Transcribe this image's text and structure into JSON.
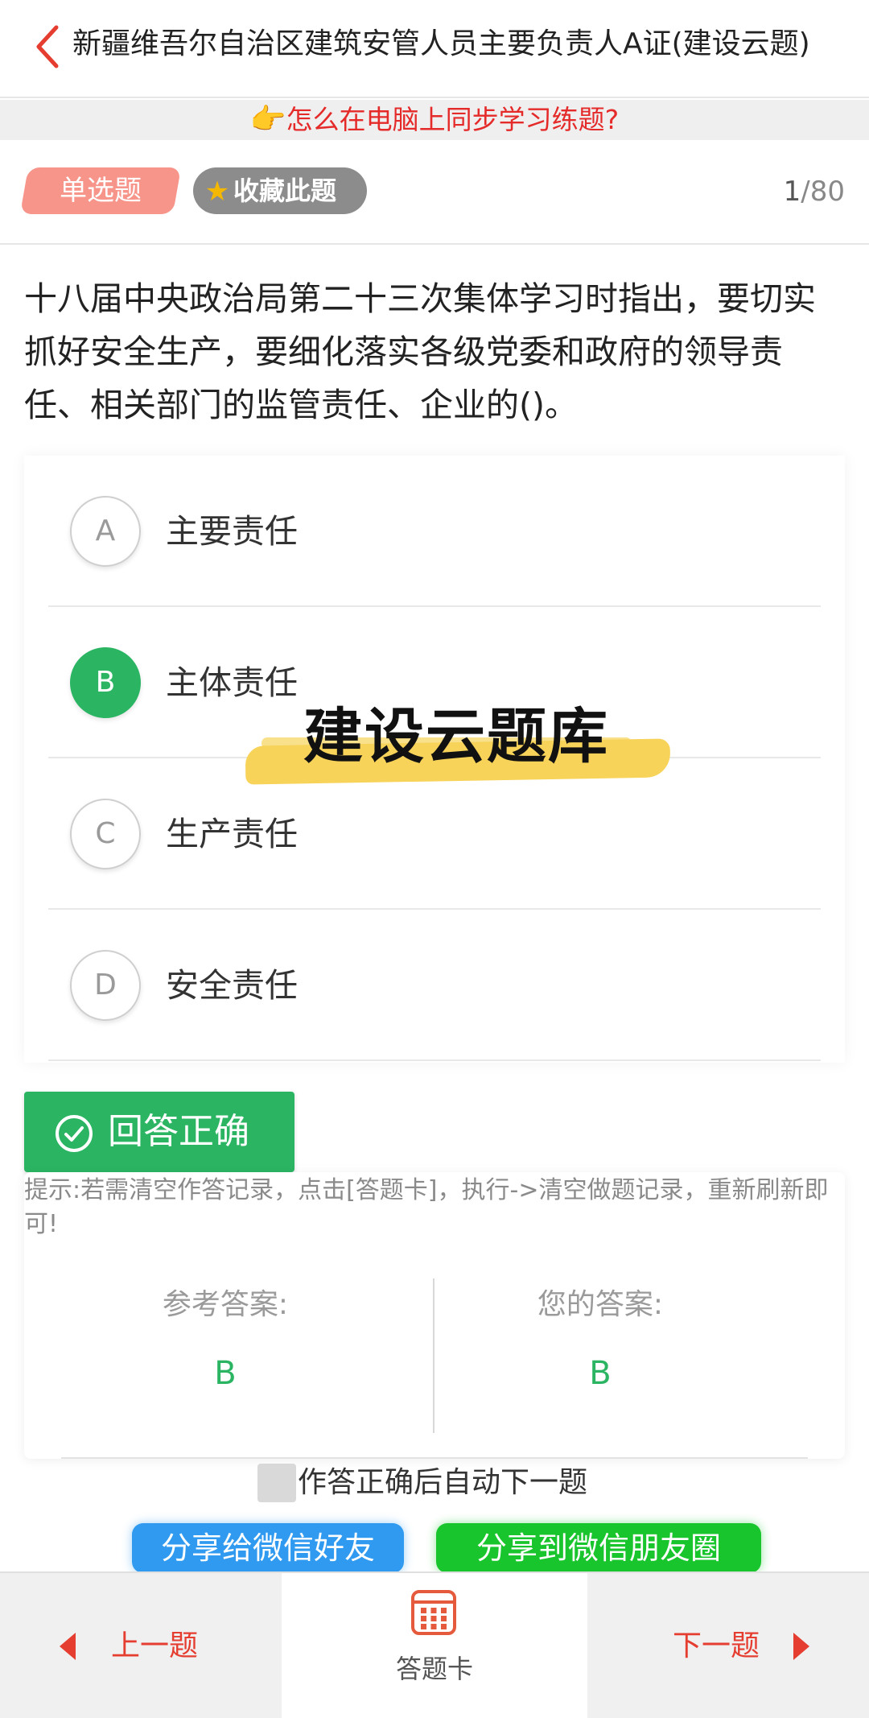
{
  "header": {
    "title": "新疆维吾尔自治区建筑安管人员主要负责人A证(建设云题)"
  },
  "banner": {
    "icon": "pointing-hand-icon",
    "text": "怎么在电脑上同步学习练题?"
  },
  "question_meta": {
    "type_label": "单选题",
    "favorite_label": "收藏此题",
    "current": "1",
    "total": "/80"
  },
  "question": {
    "text": "十八届中央政治局第二十三次集体学习时指出，要切实抓好安全生产，要细化落实各级党委和政府的领导责任、相关部门的监管责任、企业的()。"
  },
  "options": [
    {
      "letter": "A",
      "text": "主要责任",
      "selected": false
    },
    {
      "letter": "B",
      "text": "主体责任",
      "selected": true
    },
    {
      "letter": "C",
      "text": "生产责任",
      "selected": false
    },
    {
      "letter": "D",
      "text": "安全责任",
      "selected": false
    }
  ],
  "watermark": {
    "text": "建设云题库"
  },
  "result": {
    "label": "回答正确",
    "tip": "提示:若需清空作答记录，点击[答题卡]，执行->清空做题记录，重新刷新即可!",
    "reference_label": "参考答案:",
    "reference_value": "B",
    "yours_label": "您的答案:",
    "yours_value": "B"
  },
  "auto_next": {
    "label": "作答正确后自动下一题",
    "checked": false
  },
  "share": {
    "friend": "分享给微信好友",
    "moments": "分享到微信朋友圈"
  },
  "bottom_nav": {
    "prev": "上一题",
    "card": "答题卡",
    "next": "下一题"
  },
  "colors": {
    "accent_red": "#e53d30",
    "correct_green": "#2bb563",
    "share_blue": "#2f9af0",
    "share_green": "#19c52c"
  }
}
